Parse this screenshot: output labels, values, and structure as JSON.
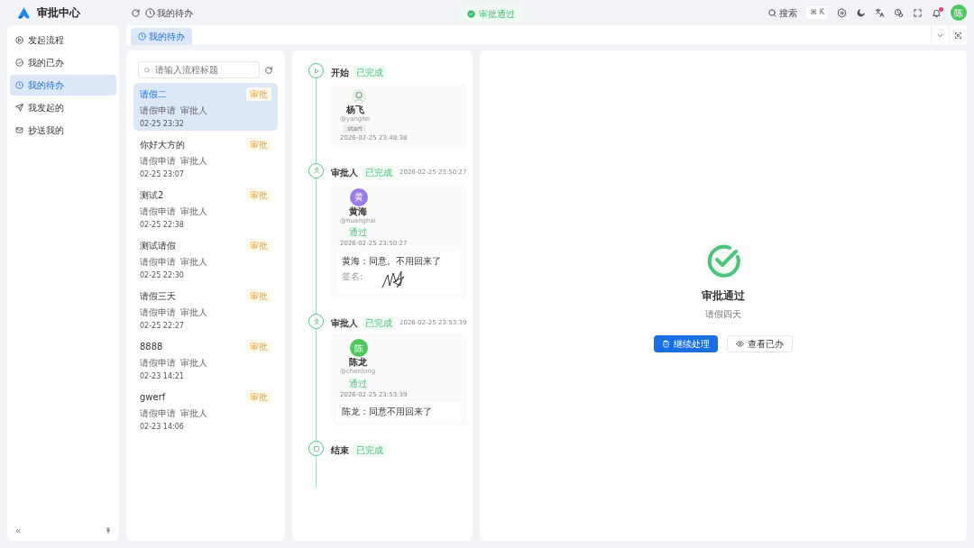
{
  "app": {
    "title": "审批中心"
  },
  "header": {
    "breadcrumb": "我的待办",
    "search_label": "搜索",
    "search_shortcut": "⌘ K",
    "avatar_letter": "陈",
    "has_notification": true
  },
  "toast": {
    "text": "审批通过"
  },
  "sidebar": {
    "items": [
      {
        "label": "发起流程",
        "selected": false
      },
      {
        "label": "我的已办",
        "selected": false
      },
      {
        "label": "我的待办",
        "selected": true
      },
      {
        "label": "我发起的",
        "selected": false
      },
      {
        "label": "抄送我的",
        "selected": false
      }
    ]
  },
  "tabs": [
    {
      "label": "我的待办",
      "selected": true
    }
  ],
  "task_list": {
    "search": {
      "placeholder": "请输入流程标题"
    },
    "items": [
      {
        "title": "请假二",
        "tag": "审批",
        "category": "请假申请",
        "role": "审批人",
        "time": "02-25 23:32",
        "selected": true
      },
      {
        "title": "你好大方的",
        "tag": "审批",
        "category": "请假申请",
        "role": "审批人",
        "time": "02-25 23:07",
        "selected": false
      },
      {
        "title": "测试2",
        "tag": "审批",
        "category": "请假申请",
        "role": "审批人",
        "time": "02-25 22:38",
        "selected": false
      },
      {
        "title": "测试请假",
        "tag": "审批",
        "category": "请假申请",
        "role": "审批人",
        "time": "02-25 22:30",
        "selected": false
      },
      {
        "title": "请假三天",
        "tag": "审批",
        "category": "请假申请",
        "role": "审批人",
        "time": "02-25 22:27",
        "selected": false
      },
      {
        "title": "8888",
        "tag": "审批",
        "category": "请假申请",
        "role": "审批人",
        "time": "02-23 14:21",
        "selected": false
      },
      {
        "title": "gwerf",
        "tag": "审批",
        "category": "请假申请",
        "role": "审批人",
        "time": "02-23 14:06",
        "selected": false
      }
    ]
  },
  "timeline": [
    {
      "kind": "start",
      "title": "开始",
      "status": "已完成",
      "card": {
        "name": "杨飞",
        "username": "@yangfei",
        "tag": "start",
        "time": "2026-02-25 23:48:38"
      }
    },
    {
      "kind": "approver",
      "title": "审批人",
      "status": "已完成",
      "time": "2026-02-25 23:50:27",
      "card": {
        "avatar_letter": "黄",
        "color": "#9b7be8",
        "name": "黄海",
        "username": "@huanghai",
        "tag": "通过",
        "time": "2026-02-25 23:50:27",
        "comment": "黄海：同意。不用回来了",
        "signature_label": "签名:"
      }
    },
    {
      "kind": "approver",
      "title": "审批人",
      "status": "已完成",
      "time": "2026-02-25 23:53:39",
      "card": {
        "avatar_letter": "陈",
        "color": "#4fc75f",
        "name": "陈龙",
        "username": "@chenlong",
        "tag": "通过",
        "time": "2026-02-25 23:53:39",
        "comment": "陈龙：同意不用回来了"
      }
    },
    {
      "kind": "end",
      "title": "结束",
      "status": "已完成"
    }
  ],
  "result": {
    "title": "审批通过",
    "subtitle": "请假四天",
    "buttons": [
      {
        "label": "继续处理",
        "kind": "primary"
      },
      {
        "label": "查看已办",
        "kind": "outline"
      }
    ]
  }
}
